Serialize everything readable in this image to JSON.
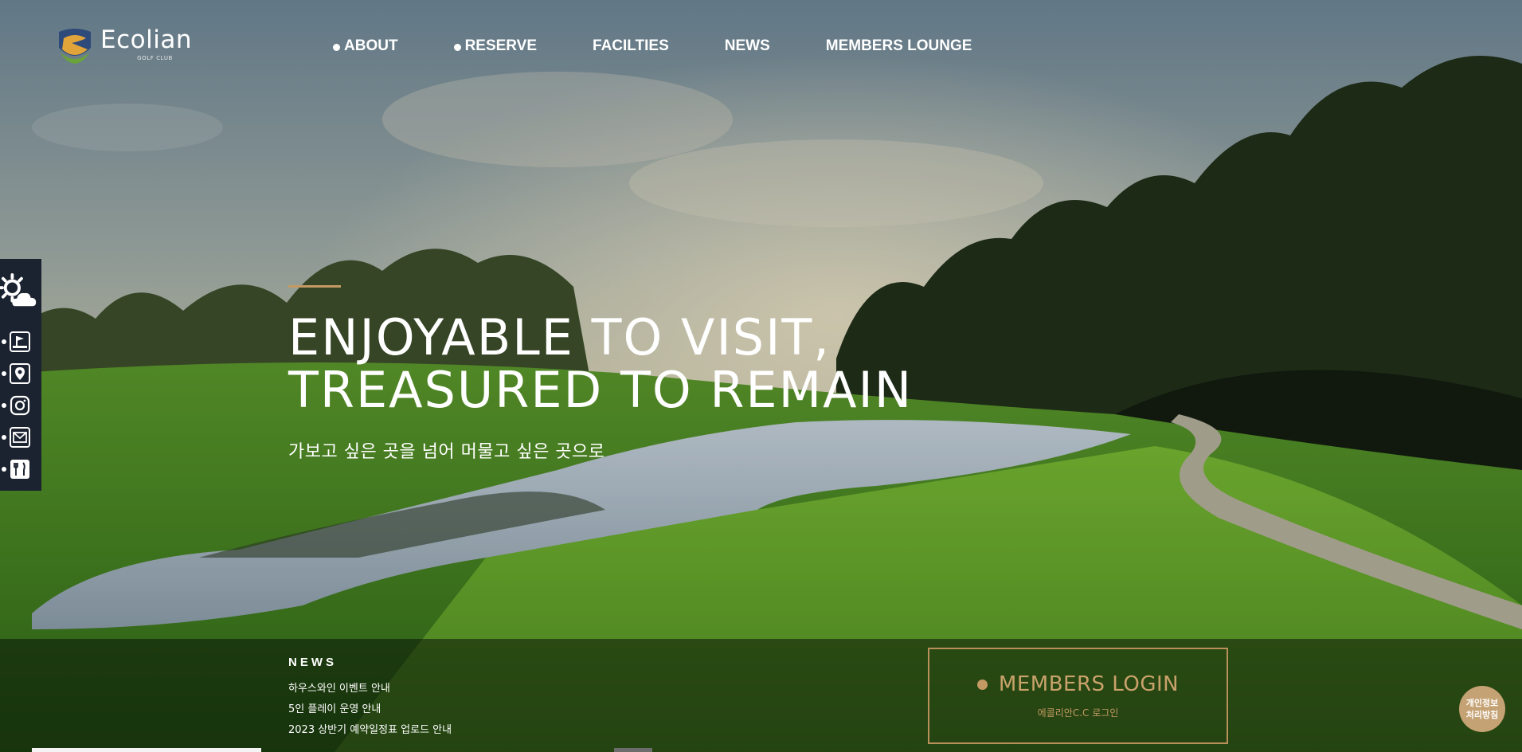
{
  "header": {
    "logo": {
      "name": "Ecolian",
      "sub": "GOLF CLUB"
    },
    "nav": [
      {
        "label": "ABOUT",
        "dot": true
      },
      {
        "label": "RESERVE",
        "dot": true
      },
      {
        "label": "FACILTIES",
        "dot": false
      },
      {
        "label": "NEWS",
        "dot": false
      },
      {
        "label": "MEMBERS LOUNGE",
        "dot": false
      }
    ]
  },
  "quick_menu": {
    "icons": [
      "weather-icon",
      "golf-flag-icon",
      "map-pin-icon",
      "instagram-icon",
      "mail-icon",
      "restaurant-icon"
    ]
  },
  "hero": {
    "line1": "ENJOYABLE TO VISIT,",
    "line2": "TREASURED TO REMAIN",
    "lead": "가보고 싶은 곳을 넘어 머물고 싶은 곳으로"
  },
  "news": {
    "title": "NEWS",
    "items": [
      "하우스와인 이벤트 안내",
      "5인 플레이 운영 안내",
      "2023 상반기 예약일정표 업로드 안내"
    ]
  },
  "login": {
    "label": "MEMBERS LOGIN",
    "sub": "에콜리안C.C 로그인"
  },
  "privacy": {
    "line1": "개인정보",
    "line2": "처리방침"
  },
  "colors": {
    "accent": "#c39a63",
    "quick_bg": "#1b2230"
  }
}
